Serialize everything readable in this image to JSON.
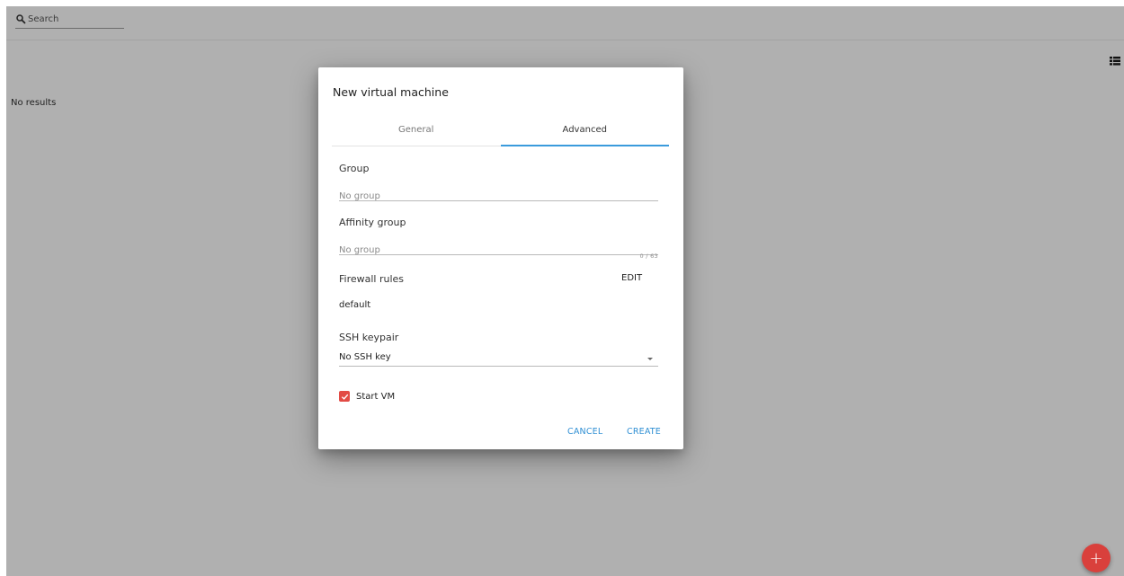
{
  "search": {
    "placeholder": "Search",
    "icon": "search-icon"
  },
  "main": {
    "empty_text": "No results",
    "view_toggle_icon": "list-view-icon"
  },
  "fab": {
    "label": "+",
    "color": "#d9403c"
  },
  "dialog": {
    "title": "New virtual machine",
    "tabs": [
      {
        "label": "General",
        "active": false
      },
      {
        "label": "Advanced",
        "active": true
      }
    ],
    "group": {
      "label": "Group",
      "placeholder": "No group"
    },
    "affinity_group": {
      "label": "Affinity group",
      "placeholder": "No group",
      "char_count": "0 / 63"
    },
    "firewall": {
      "label": "Firewall rules",
      "edit_label": "EDIT",
      "value": "default"
    },
    "ssh": {
      "label": "SSH keypair",
      "value": "No SSH key"
    },
    "start_vm": {
      "label": "Start VM",
      "checked": true
    },
    "actions": {
      "cancel": "CANCEL",
      "create": "CREATE"
    },
    "colors": {
      "accent": "#2f8fd3",
      "checkbox": "#e24b45",
      "tab_indicator": "#3a9bdc"
    }
  }
}
